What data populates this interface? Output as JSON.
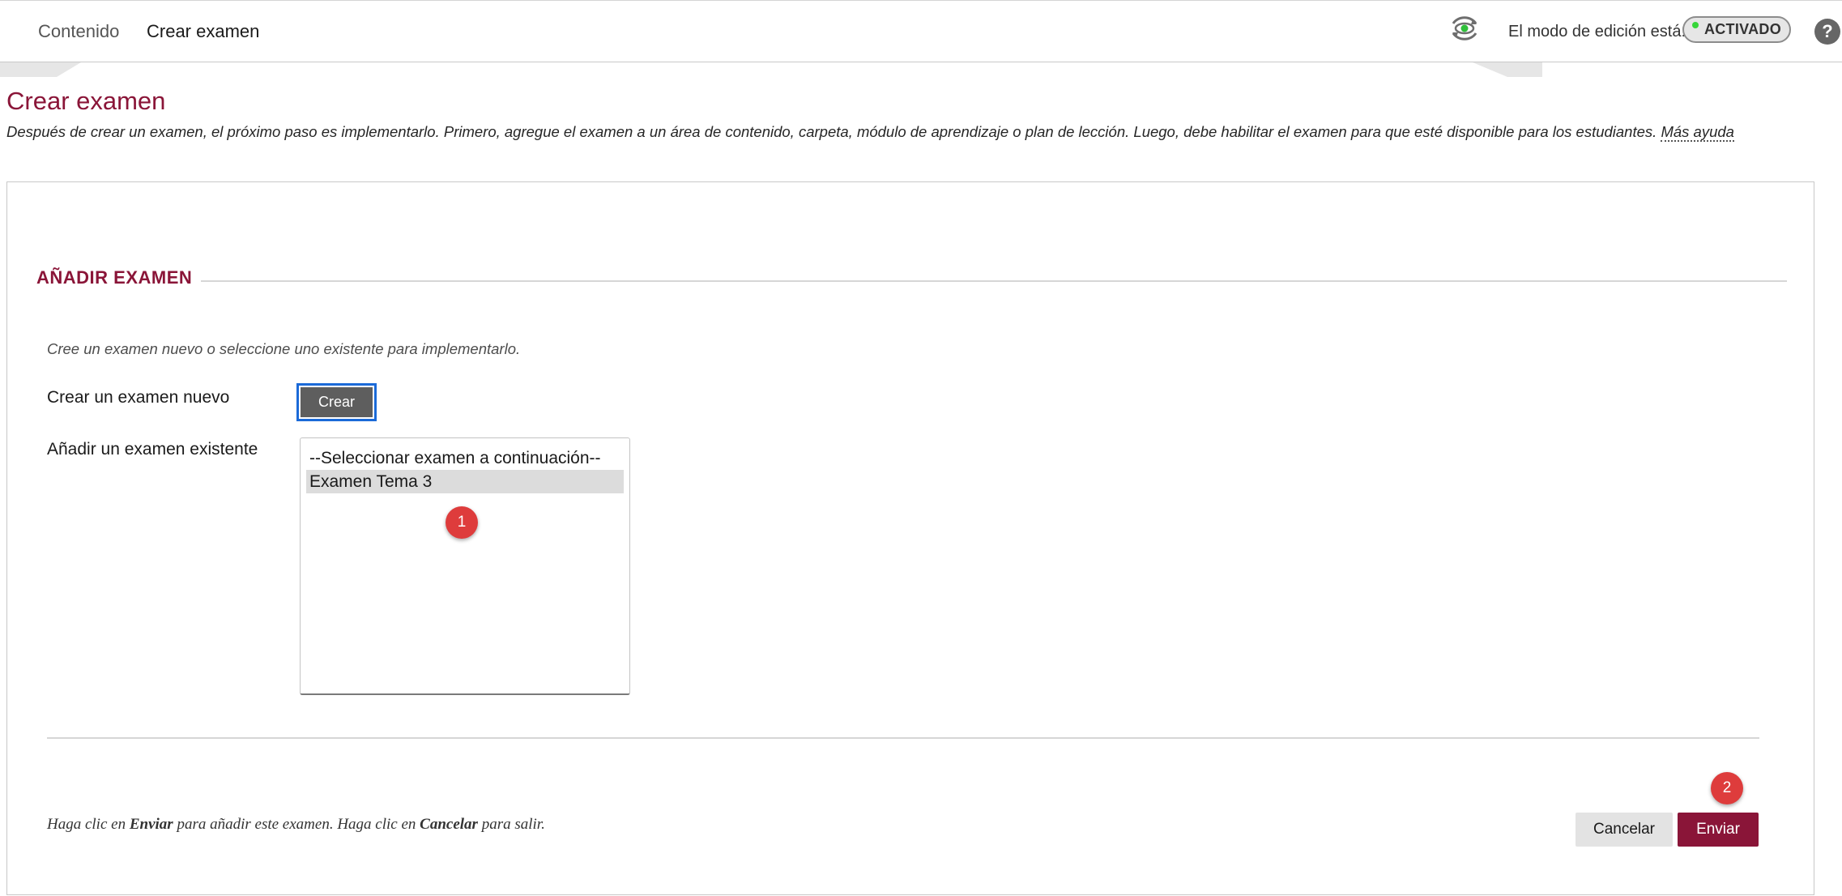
{
  "breadcrumb": {
    "items": [
      {
        "label": "Contenido"
      },
      {
        "label": "Crear examen"
      }
    ]
  },
  "toolbar": {
    "preview_icon": "eye-refresh-icon",
    "edit_mode_label": "El modo de edición está:",
    "edit_mode_value": "ACTIVADO",
    "edit_mode_indicator_color": "#37d63a",
    "help_symbol": "?"
  },
  "header": {
    "title": "Crear examen",
    "description": "Después de crear un examen, el próximo paso es implementarlo. Primero, agregue el examen a un área de contenido, carpeta, módulo de aprendizaje o plan de lección. Luego, debe habilitar el examen para que esté disponible para los estudiantes.",
    "help_link": "Más ayuda"
  },
  "section": {
    "title": "AÑADIR EXAMEN",
    "instructions": "Cree un examen nuevo o seleccione uno existente para implementarlo.",
    "create_label": "Crear un examen nuevo",
    "create_button": "Crear",
    "existing_label": "Añadir un examen existente",
    "exam_options": [
      {
        "label": "--Seleccionar examen a continuación--",
        "selected": false
      },
      {
        "label": "Examen Tema 3",
        "selected": true
      }
    ]
  },
  "annotations": {
    "badge_1": "1",
    "badge_2": "2",
    "badge_color": "#de3c3c"
  },
  "footer": {
    "note_prefix": "Haga clic en ",
    "note_submit": "Enviar",
    "note_middle": " para añadir este examen. Haga clic en ",
    "note_cancel": "Cancelar",
    "note_suffix": " para salir.",
    "cancel_button": "Cancelar",
    "submit_button": "Enviar"
  },
  "colors": {
    "brand": "#8a1538",
    "create_button_bg": "#5e5e5e",
    "focus_ring": "#1b6ad8"
  }
}
